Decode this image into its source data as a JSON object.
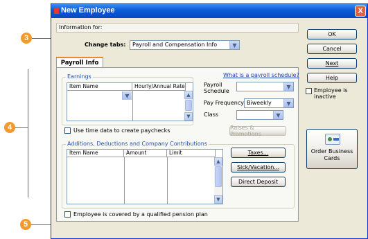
{
  "callouts": [
    "3",
    "4",
    "5"
  ],
  "window": {
    "title": "New Employee",
    "close_glyph": "X"
  },
  "info_for": "Information for:",
  "change_tabs": {
    "label": "Change tabs:",
    "value": "Payroll and Compensation Info"
  },
  "side_buttons": {
    "ok": "OK",
    "cancel": "Cancel",
    "next": "Next",
    "help": "Help",
    "inactive_label_1": "Employee is",
    "inactive_label_2": "inactive"
  },
  "tab": {
    "label": "Payroll Info"
  },
  "earnings": {
    "legend": "Earnings",
    "columns": [
      "Item Name",
      "Hourly/Annual Rate"
    ]
  },
  "payroll_schedule_link": "What is a payroll schedule?",
  "payroll_schedule": {
    "label_1": "Payroll",
    "label_2": "Schedule",
    "value": ""
  },
  "pay_frequency": {
    "label": "Pay Frequency",
    "value": "Biweekly"
  },
  "class": {
    "label": "Class",
    "value": ""
  },
  "use_time_data": "Use time data to create paychecks",
  "raises_button": "Raises & Promotions",
  "additions": {
    "legend": "Additions, Deductions and Company Contributions",
    "columns": [
      "Item Name",
      "Amount",
      "Limit"
    ]
  },
  "taxes_button": "Taxes...",
  "sick_button": "Sick/Vacation...",
  "direct_deposit_button": "Direct Deposit",
  "pension_checkbox": "Employee is covered by a qualified pension plan",
  "business_cards": {
    "line1": "Order Business",
    "line2": "Cards"
  },
  "colors": {
    "callout": "#f29a2e",
    "titlebar": "#0a5bd6",
    "tab_accent": "#e68b2c",
    "link": "#1a3fb0"
  },
  "icons": [
    "close-icon",
    "dropdown-arrow-icon",
    "scroll-up-icon",
    "scroll-down-icon",
    "business-card-icon",
    "app-icon"
  ]
}
